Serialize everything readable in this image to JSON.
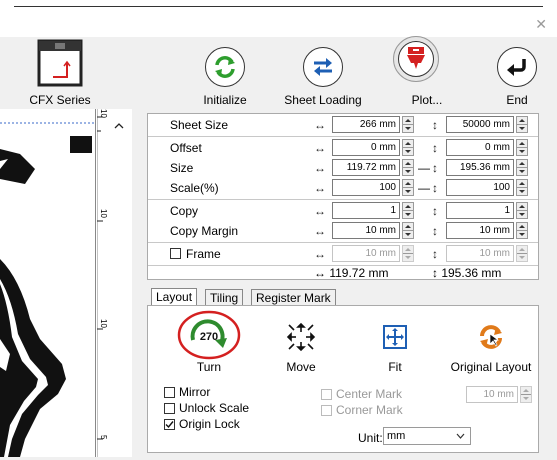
{
  "window": {
    "close_glyph": "✕"
  },
  "toolbar": {
    "device_label": "CFX Series",
    "initialize": "Initialize",
    "sheet_loading": "Sheet Loading",
    "plot": "Plot...",
    "end": "End"
  },
  "ruler": {
    "marks": [
      "10",
      "10",
      "10",
      "5"
    ]
  },
  "settings": {
    "sheet_size": {
      "label": "Sheet Size",
      "width": "266 mm",
      "height": "50000 mm"
    },
    "offset": {
      "label": "Offset",
      "x": "0 mm",
      "y": "0 mm"
    },
    "size": {
      "label": "Size",
      "width": "119.72 mm",
      "height": "195.36 mm"
    },
    "scale": {
      "label": "Scale(%)",
      "x": "100",
      "y": "100"
    },
    "copy": {
      "label": "Copy",
      "x": "1",
      "y": "1"
    },
    "copy_margin": {
      "label": "Copy Margin",
      "x": "10 mm",
      "y": "10 mm"
    },
    "frame": {
      "label": "Frame",
      "x": "10 mm",
      "y": "10 mm",
      "checked": false
    },
    "total": {
      "width": "↔ 119.72 mm",
      "height": "↕ 195.36 mm"
    }
  },
  "tabs": [
    "Layout",
    "Tiling",
    "Register Mark"
  ],
  "layout": {
    "turn": "Turn",
    "turn_value": "270",
    "move": "Move",
    "fit": "Fit",
    "original_layout": "Original Layout",
    "mirror": "Mirror",
    "unlock_scale": "Unlock Scale",
    "origin_lock": "Origin Lock",
    "center_mark": "Center Mark",
    "corner_mark": "Corner Mark",
    "mark_size": "10 mm",
    "unit_label": "Unit:",
    "unit_value": "mm"
  },
  "colors": {
    "accent_red": "#d42020",
    "turn_green": "#2e8b2e",
    "fit_blue": "#1e5fb4",
    "orig_orange": "#e07a1a"
  }
}
